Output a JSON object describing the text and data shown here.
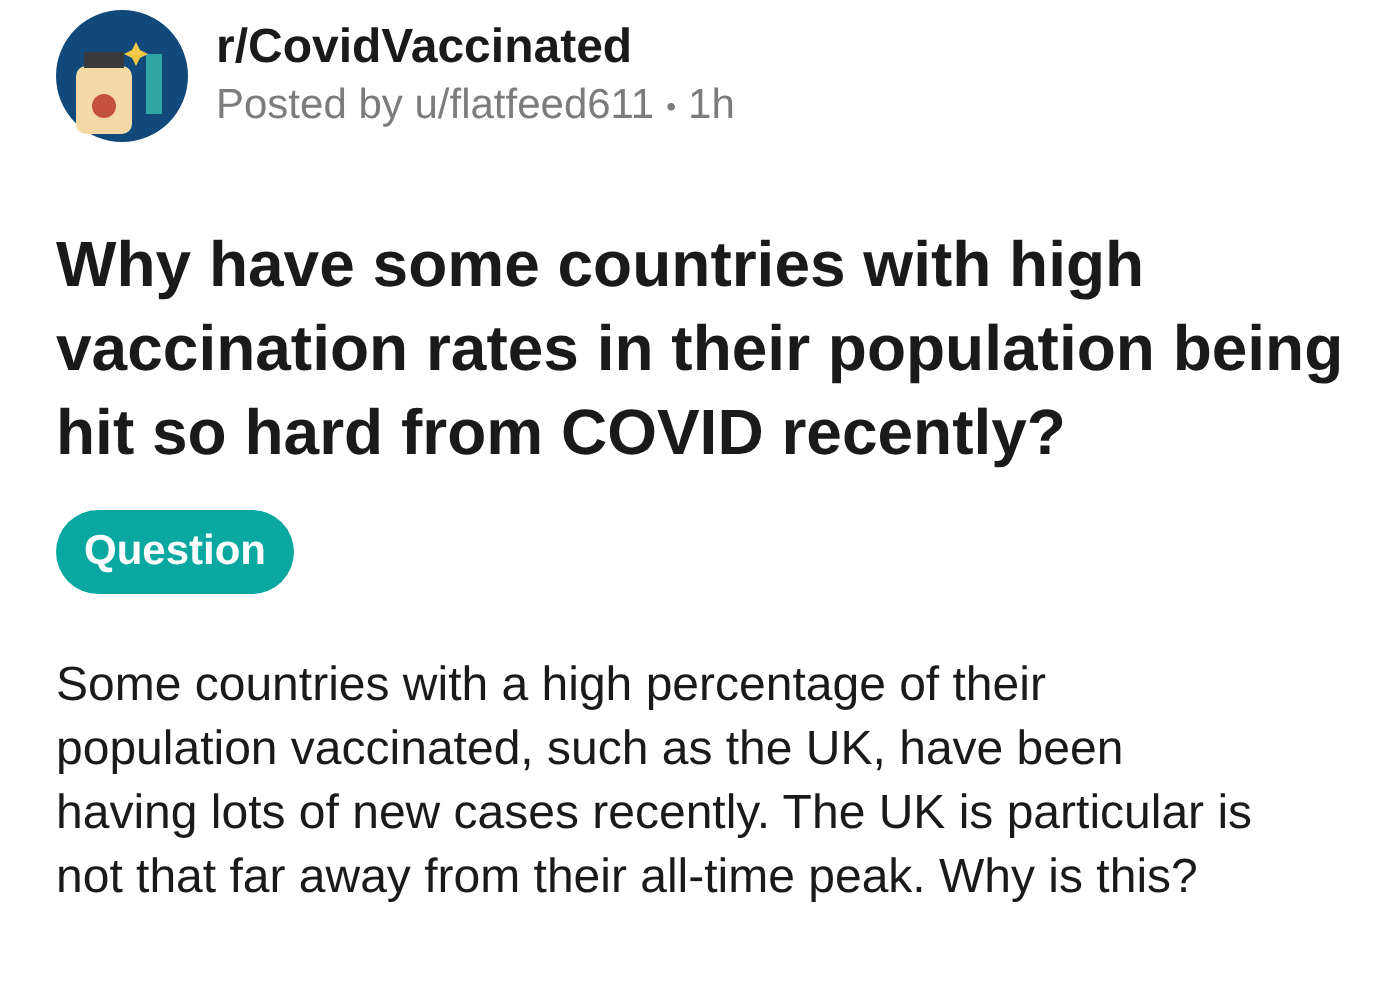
{
  "subreddit": "r/CovidVaccinated",
  "meta": {
    "posted_by": "Posted by u/flatfeed611",
    "separator": "•",
    "age": "1h"
  },
  "title": "Why have some countries with high vaccination rates in their population being hit so hard from COVID recently?",
  "flair": "Question",
  "body": "Some countries with a high percentage of their population vaccinated, such as the UK, have been having lots of new cases recently. The UK is particular is not that far away from their all-time peak. Why is this?"
}
